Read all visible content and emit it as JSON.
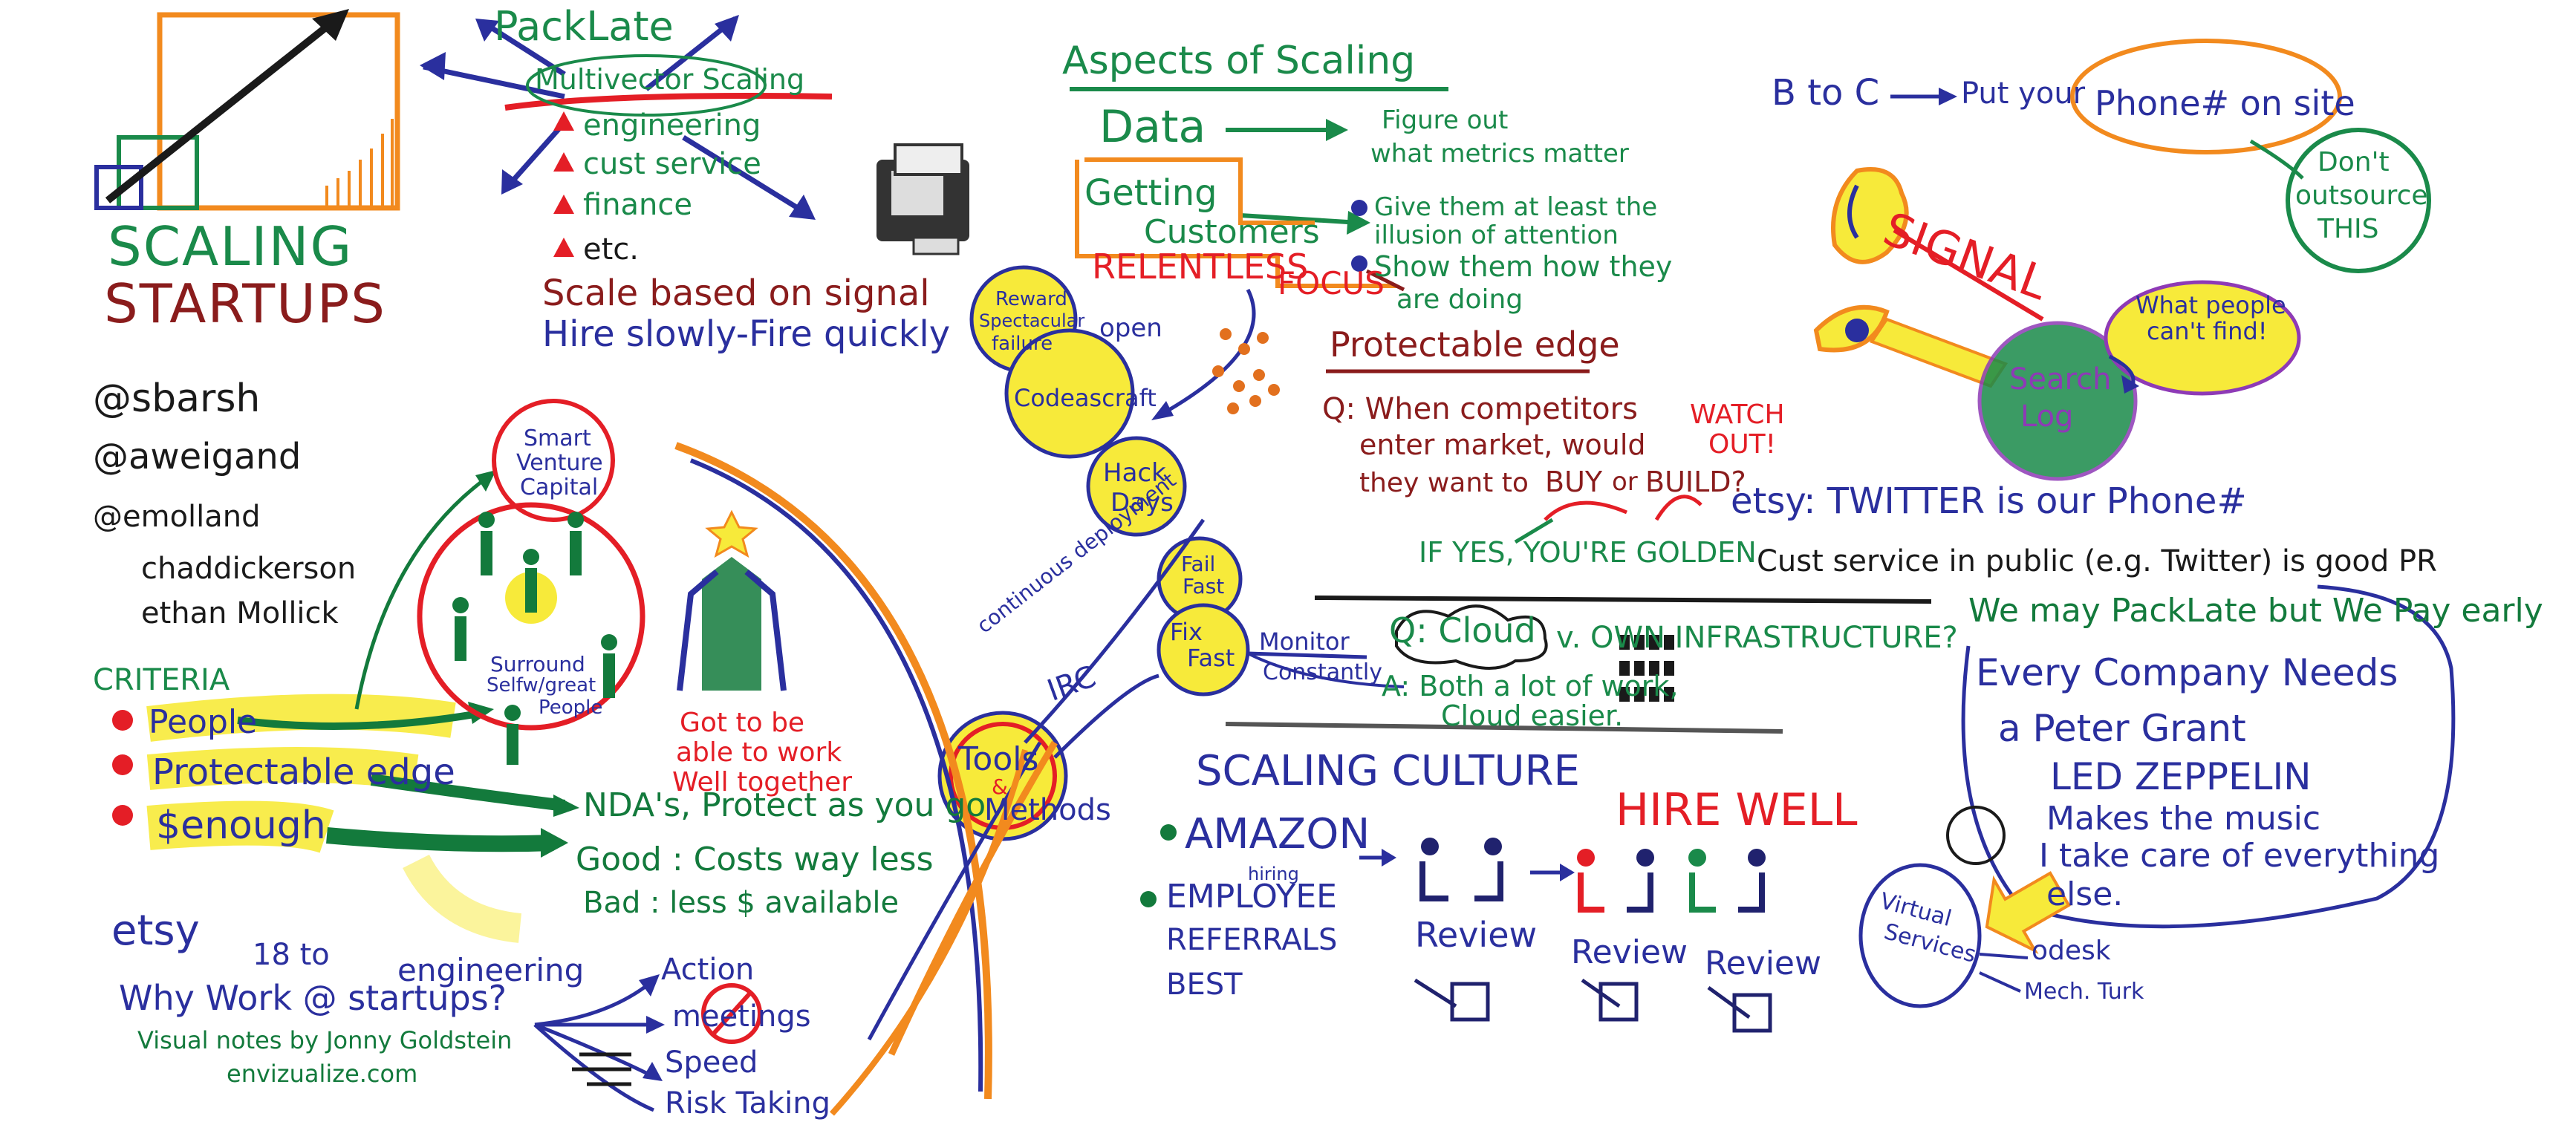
{
  "colors": {
    "green": "#1a8a4a",
    "darkgreen": "#137a3c",
    "maroon": "#8a1c1c",
    "red": "#e41e26",
    "blue": "#2a2f9e",
    "navy": "#20226e",
    "orange": "#f28a1e",
    "yellow": "#f7ea3a",
    "purple": "#8e3ab6",
    "black": "#1a1a1a"
  },
  "title": {
    "line1": "SCALING",
    "line2": "STARTUPS"
  },
  "handles": [
    "@sbarsh",
    "@aweigand",
    "@emolland",
    "chaddickerson",
    "ethan Mollick"
  ],
  "packlate": {
    "heading": "PackLate",
    "sub": "Multivector Scaling",
    "items": [
      "engineering",
      "cust service",
      "finance",
      "etc."
    ],
    "signal": "Scale based on signal",
    "hire": "Hire slowly-Fire quickly"
  },
  "criteria": {
    "heading": "CRITERIA",
    "items": [
      "People",
      "Protectable edge",
      "$enough"
    ],
    "smart_vc": [
      "Smart",
      "Venture",
      "Capital"
    ],
    "surround": [
      "Surround",
      "Selfw/great",
      "People"
    ],
    "work_together": [
      "Got to be",
      "able to work",
      "Well together"
    ],
    "nda": "NDA's, Protect as you go",
    "good": "Good : Costs way less",
    "bad": "Bad : less $ available"
  },
  "etsy": {
    "etsy": "etsy",
    "eighteen": "18 to",
    "engineering": "engineering",
    "why": "Why Work @ startups?",
    "credit1": "Visual notes by Jonny Goldstein",
    "credit2": "envizualize.com",
    "action": "Action",
    "meetings": "meetings",
    "speed": "Speed",
    "risk": "Risk Taking"
  },
  "aspects": {
    "heading": "Aspects of Scaling",
    "data": "Data",
    "figure": "Figure out",
    "metrics": "what metrics matter",
    "getting": "Getting",
    "customers": "Customers",
    "relentless": "RELENTLESS",
    "focus": "FOCUS",
    "give1": "Give them at least the",
    "give2": "illusion of attention",
    "show1": "Show them how they",
    "show2": "are doing",
    "protect": "Protectable edge",
    "q1": "Q: When competitors",
    "q2": "enter market, would",
    "q3": "they want to",
    "buy": "BUY",
    "or": "or",
    "build": "BUILD?",
    "watch": "WATCH",
    "out": "OUT!",
    "golden": "IF YES, YOU'RE GOLDEN"
  },
  "tools": {
    "reward": [
      "Reward",
      "Spectacular",
      "failure"
    ],
    "open": "open",
    "codeascraft": "Codeascraft",
    "hack": [
      "Hack",
      "Days"
    ],
    "fail": [
      "Fail",
      "Fast"
    ],
    "fix": [
      "Fix",
      "Fast"
    ],
    "continuous": "continuous deployment",
    "irc": "IRC",
    "tools": "Tools",
    "amp": "&",
    "methods": "Methods",
    "monitor": "Monitor",
    "constantly": "Constantly",
    "cloud_q": "Q: Cloud",
    "cloud_v": "v. OWN INFRASTRUCTURE?",
    "cloud_a": "A: Both a lot of work,",
    "cloud_easier": "Cloud easier."
  },
  "culture": {
    "heading": "SCALING CULTURE",
    "hirewell": "HIRE WELL",
    "amazon": "AMAZON",
    "hiring": "hiring",
    "employee": "EMPLOYEE",
    "referrals": "REFERRALS",
    "best": "BEST",
    "reviews": [
      "Review",
      "Review",
      "Review"
    ]
  },
  "b2c": {
    "b2c": "B to C",
    "put": "Put your",
    "phone": "Phone# on site",
    "dont": [
      "Don't",
      "outsource",
      "THIS"
    ],
    "signal": "SIGNAL",
    "what": [
      "What people",
      "can't find!"
    ],
    "search": [
      "Search",
      "Log"
    ],
    "etsy_twitter": "etsy: TWITTER is our Phone#",
    "cust": "Cust service in public (e.g. Twitter) is good PR",
    "packlate": "We may PackLate but We Pay early"
  },
  "peter": {
    "line1": "Every Company Needs",
    "line2": "a Peter Grant",
    "line3": "LED ZEPPELIN",
    "line4": "Makes the music",
    "line5": "I take care of everything",
    "line6": "else.",
    "virtual": [
      "Virtual",
      "Services"
    ],
    "odesk": "odesk",
    "mech": "Mech. Turk"
  }
}
